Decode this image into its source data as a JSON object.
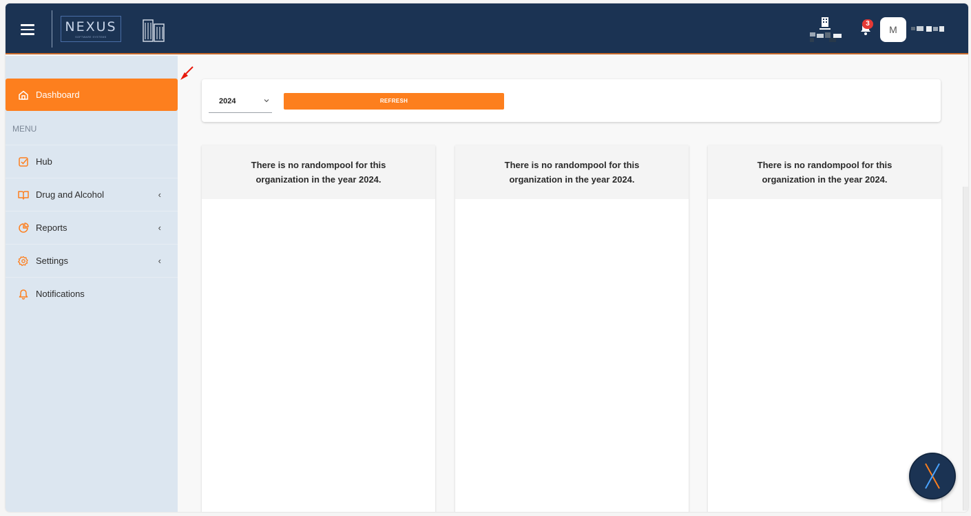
{
  "header": {
    "logo_text": "NEXUS",
    "logo_sub": "SOFTWARE SYSTEMS",
    "notification_count": "3",
    "avatar_initial": "M"
  },
  "sidebar": {
    "active_item": "Dashboard",
    "menu_label": "MENU",
    "items": [
      {
        "label": "Hub",
        "icon": "checkbox-icon",
        "expandable": false
      },
      {
        "label": "Drug and Alcohol",
        "icon": "book-icon",
        "expandable": true
      },
      {
        "label": "Reports",
        "icon": "pie-chart-icon",
        "expandable": true
      },
      {
        "label": "Settings",
        "icon": "gear-icon",
        "expandable": true
      },
      {
        "label": "Notifications",
        "icon": "bell-icon",
        "expandable": false
      }
    ],
    "chevron": "‹"
  },
  "filter": {
    "year_value": "2024",
    "refresh_label": "REFRESH"
  },
  "cards": [
    {
      "message": "There is no randompool for this organization in the year 2024."
    },
    {
      "message": "There is no randompool for this organization in the year 2024."
    },
    {
      "message": "There is no randompool for this organization in the year 2024."
    }
  ],
  "colors": {
    "topbar": "#1b3353",
    "accent": "#fd7f1e",
    "sidebar": "#dce6f0",
    "badge": "#e53935"
  }
}
